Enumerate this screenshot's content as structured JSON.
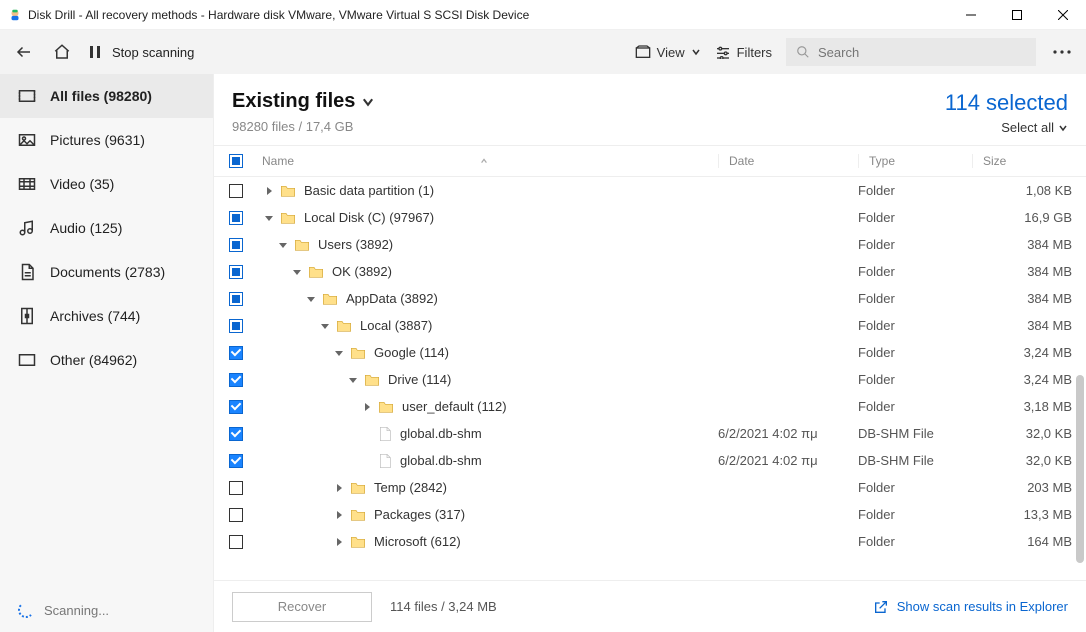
{
  "window": {
    "title": "Disk Drill - All recovery methods - Hardware disk VMware, VMware Virtual S SCSI Disk Device"
  },
  "toolbar": {
    "stop_label": "Stop scanning",
    "view_label": "View",
    "filters_label": "Filters",
    "search_placeholder": "Search"
  },
  "sidebar": {
    "items": [
      {
        "label": "All files (98280)"
      },
      {
        "label": "Pictures (9631)"
      },
      {
        "label": "Video (35)"
      },
      {
        "label": "Audio (125)"
      },
      {
        "label": "Documents (2783)"
      },
      {
        "label": "Archives (744)"
      },
      {
        "label": "Other (84962)"
      }
    ],
    "status": "Scanning..."
  },
  "main": {
    "title": "Existing files",
    "subtitle": "98280 files / 17,4 GB",
    "selected_label": "114 selected",
    "select_all_label": "Select all",
    "headers": {
      "name": "Name",
      "date": "Date",
      "type": "Type",
      "size": "Size"
    },
    "rows": [
      {
        "check": "empty",
        "indent": 0,
        "expand": "right",
        "icon": "folder",
        "name": "Basic data partition (1)",
        "date": "",
        "type": "Folder",
        "size": "1,08 KB"
      },
      {
        "check": "partial",
        "indent": 0,
        "expand": "down",
        "icon": "folder",
        "name": "Local Disk (C) (97967)",
        "date": "",
        "type": "Folder",
        "size": "16,9 GB"
      },
      {
        "check": "partial",
        "indent": 1,
        "expand": "down",
        "icon": "folder",
        "name": "Users (3892)",
        "date": "",
        "type": "Folder",
        "size": "384 MB"
      },
      {
        "check": "partial",
        "indent": 2,
        "expand": "down",
        "icon": "folder",
        "name": "OK (3892)",
        "date": "",
        "type": "Folder",
        "size": "384 MB"
      },
      {
        "check": "partial",
        "indent": 3,
        "expand": "down",
        "icon": "folder",
        "name": "AppData (3892)",
        "date": "",
        "type": "Folder",
        "size": "384 MB"
      },
      {
        "check": "partial",
        "indent": 4,
        "expand": "down",
        "icon": "folder",
        "name": "Local (3887)",
        "date": "",
        "type": "Folder",
        "size": "384 MB"
      },
      {
        "check": "checked",
        "indent": 5,
        "expand": "down",
        "icon": "folder",
        "name": "Google (114)",
        "date": "",
        "type": "Folder",
        "size": "3,24 MB"
      },
      {
        "check": "checked",
        "indent": 6,
        "expand": "down",
        "icon": "folder",
        "name": "Drive (114)",
        "date": "",
        "type": "Folder",
        "size": "3,24 MB"
      },
      {
        "check": "checked",
        "indent": 7,
        "expand": "right",
        "icon": "folder",
        "name": "user_default (112)",
        "date": "",
        "type": "Folder",
        "size": "3,18 MB"
      },
      {
        "check": "checked",
        "indent": 7,
        "expand": "none",
        "icon": "file",
        "name": "global.db-shm",
        "date": "6/2/2021 4:02 πμ",
        "type": "DB-SHM File",
        "size": "32,0 KB"
      },
      {
        "check": "checked",
        "indent": 7,
        "expand": "none",
        "icon": "file",
        "name": "global.db-shm",
        "date": "6/2/2021 4:02 πμ",
        "type": "DB-SHM File",
        "size": "32,0 KB"
      },
      {
        "check": "empty",
        "indent": 5,
        "expand": "right",
        "icon": "folder",
        "name": "Temp (2842)",
        "date": "",
        "type": "Folder",
        "size": "203 MB"
      },
      {
        "check": "empty",
        "indent": 5,
        "expand": "right",
        "icon": "folder",
        "name": "Packages (317)",
        "date": "",
        "type": "Folder",
        "size": "13,3 MB"
      },
      {
        "check": "empty",
        "indent": 5,
        "expand": "right",
        "icon": "folder",
        "name": "Microsoft (612)",
        "date": "",
        "type": "Folder",
        "size": "164 MB"
      }
    ]
  },
  "footer": {
    "recover_label": "Recover",
    "info": "114 files / 3,24 MB",
    "link": "Show scan results in Explorer"
  }
}
